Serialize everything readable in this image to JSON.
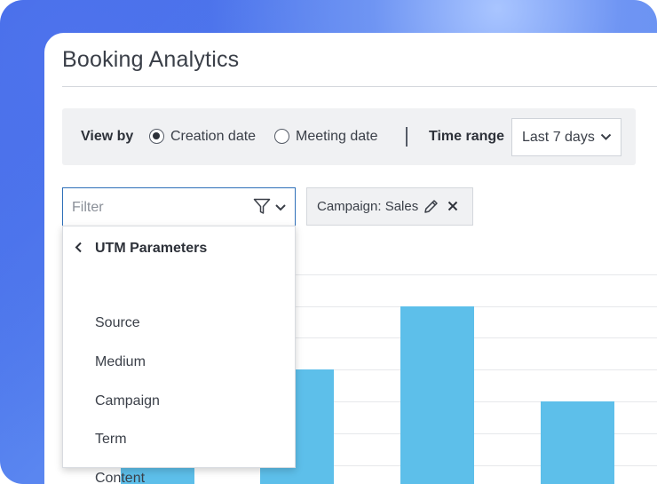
{
  "page": {
    "title": "Booking Analytics"
  },
  "controls": {
    "view_by_label": "View by",
    "options": [
      {
        "label": "Creation date",
        "selected": true
      },
      {
        "label": "Meeting date",
        "selected": false
      }
    ],
    "time_range_label": "Time range",
    "time_range_value": "Last 7 days"
  },
  "filter": {
    "placeholder": "Filter",
    "icons": [
      "funnel-icon",
      "chevron-down-icon"
    ]
  },
  "chip": {
    "label": "Campaign: Sales",
    "icons": [
      "pencil-icon",
      "close-icon"
    ]
  },
  "dropdown": {
    "header": "UTM Parameters",
    "items": [
      "Source",
      "Medium",
      "Campaign",
      "Term",
      "Content"
    ]
  },
  "colors": {
    "accent_border": "#2e6fb8",
    "bar": "#5dbfea",
    "background_gradient": [
      "#3d66e6",
      "#7aa2f5"
    ]
  }
}
